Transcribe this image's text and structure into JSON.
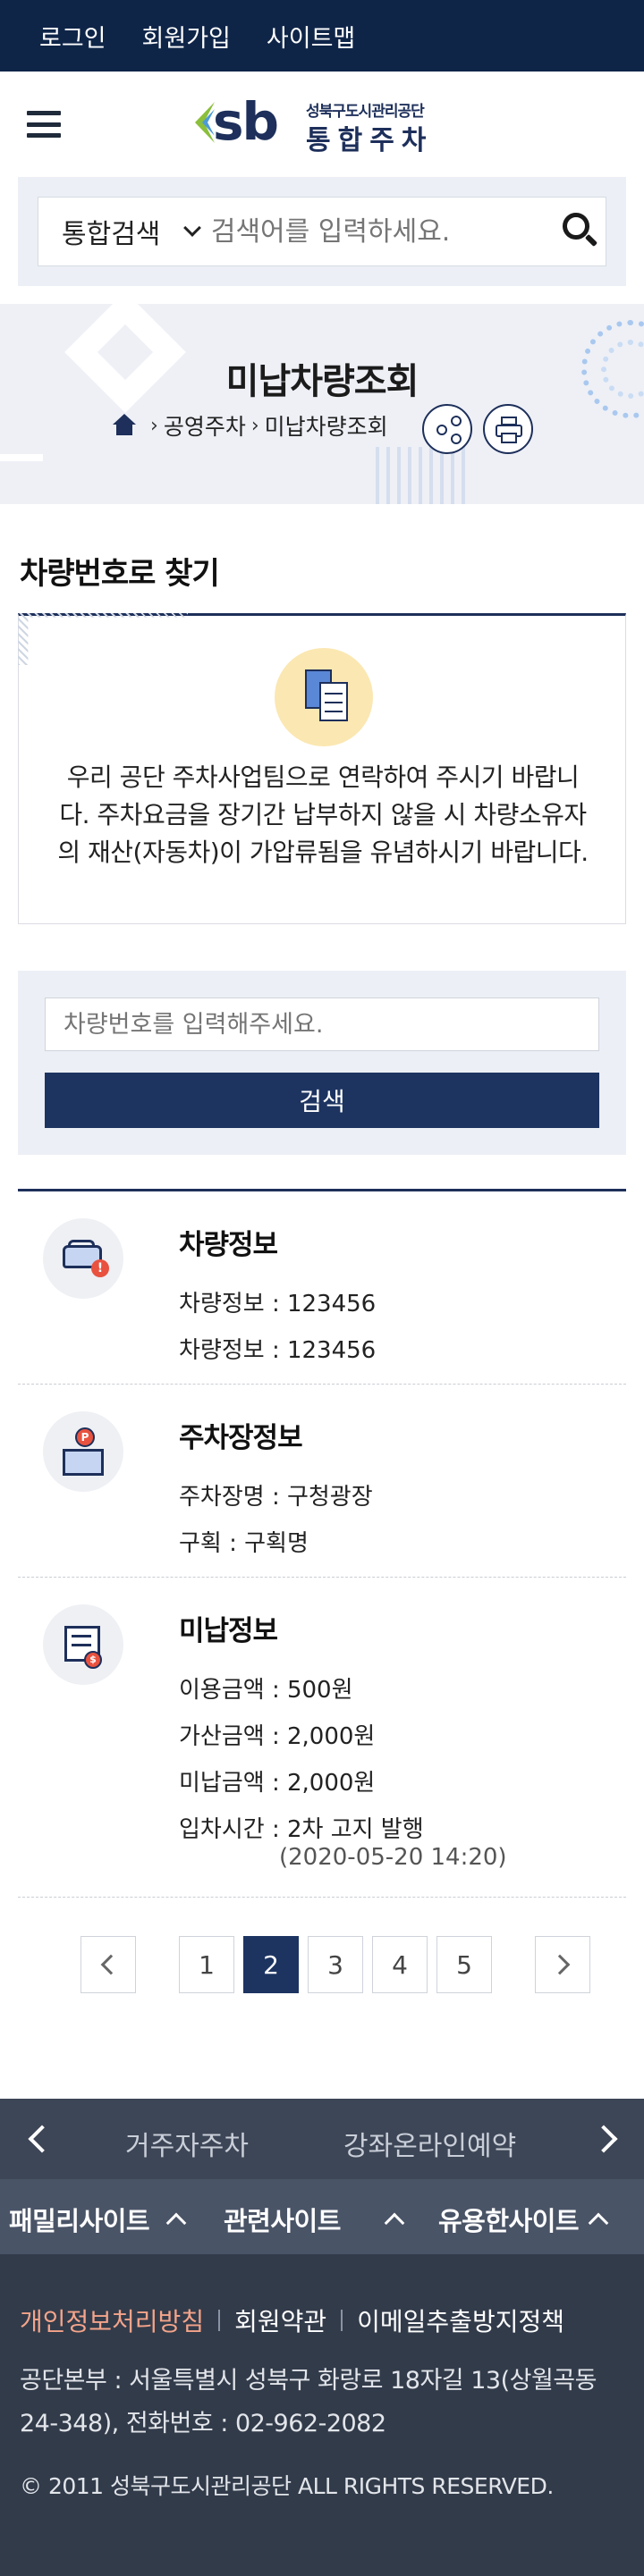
{
  "topbar": {
    "login": "로그인",
    "signup": "회원가입",
    "sitemap": "사이트맵"
  },
  "logo": {
    "mark": "sb",
    "sub": "성북구도시관리공단",
    "main": "통합주차"
  },
  "search": {
    "category": "통합검색",
    "placeholder": "검색어를 입력하세요."
  },
  "hero": {
    "title": "미납차량조회",
    "breadcrumb": [
      "공영주차",
      "미납차량조회"
    ]
  },
  "section": {
    "title": "차량번호로 찾기"
  },
  "notice": {
    "text": "우리 공단 주차사업팀으로 연락하여 주시기 바랍니다. 주차요금을 장기간 납부하지 않을 시 차량소유자의 재산(자동차)이 가압류됨을 유념하시기 바랍니다."
  },
  "car_search": {
    "placeholder": "차량번호를 입력해주세요.",
    "button": "검색"
  },
  "info": {
    "vehicle": {
      "title": "차량정보",
      "rows": [
        "차량정보 : 123456",
        "차량정보 : 123456"
      ]
    },
    "parking": {
      "title": "주차장정보",
      "rows": [
        "주차장명 : 구청광장",
        "구획 : 구획명"
      ]
    },
    "unpaid": {
      "title": "미납정보",
      "rows": [
        "이용금액 : 500원",
        "가산금액 : 2,000원",
        "미납금액 : 2,000원",
        "입차시간 : 2차 고지 발행"
      ],
      "date": "(2020-05-20 14:20)"
    }
  },
  "pagination": {
    "pages": [
      "1",
      "2",
      "3",
      "4",
      "5"
    ],
    "current": "2"
  },
  "footer": {
    "slider": [
      "거주자주차",
      "강좌온라인예약"
    ],
    "sites": [
      "패밀리사이트",
      "관련사이트",
      "유용한사이트"
    ],
    "links": [
      "개인정보처리방침",
      "회원약관",
      "이메일추출방지정책"
    ],
    "address": "공단본부 : 서울특별시 성북구 화랑로 18자길 13(상월곡동 24-348), 전화번호 : 02-962-2082",
    "copyright": "© 2011 성북구도시관리공단 ALL RIGHTS RESERVED."
  },
  "colors": {
    "navy": "#0f2548",
    "accent": "#1d3461",
    "footer": "#323b4a",
    "link_highlight": "#f4a48a"
  }
}
